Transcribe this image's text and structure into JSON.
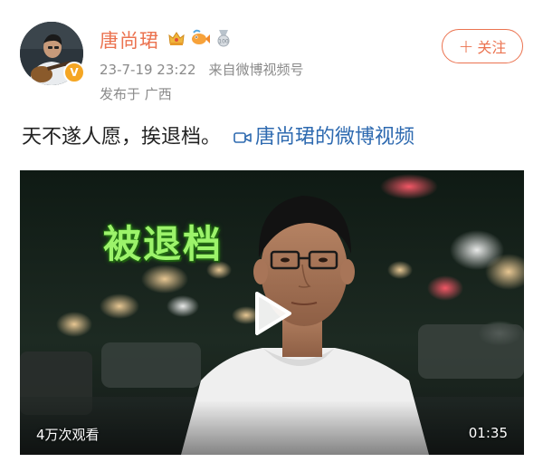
{
  "post": {
    "author": {
      "name": "唐尚珺",
      "verified": true,
      "badges": [
        "crown-badge-icon",
        "fish-badge-icon",
        "medal-badge-icon"
      ]
    },
    "timestamp": "23-7-19 23:22",
    "source": "来自微博视频号",
    "location": "发布于 广西",
    "follow_label": "关注",
    "text": "天不遂人愿，挨退档。",
    "video_link_label": "唐尚珺的微博视频",
    "video": {
      "overlay_title": "被退档",
      "view_count": "4万次观看",
      "duration": "01:35"
    }
  },
  "colors": {
    "accent": "#eb7350",
    "link": "#2e6ab0",
    "overlay_text": "#9cf36a"
  }
}
